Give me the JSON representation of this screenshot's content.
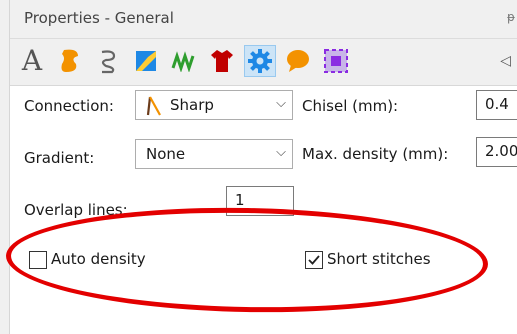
{
  "panel": {
    "title": "Properties - General",
    "pin_glyph": "ᵽ"
  },
  "toolbar": {
    "icons": [
      {
        "name": "text-A-icon",
        "glyph": "A",
        "color": "#555555"
      },
      {
        "name": "fill-shape-icon",
        "color": "#f39200"
      },
      {
        "name": "outline-path-icon",
        "color": "#666666"
      },
      {
        "name": "applique-icon",
        "color": "#1e88e5"
      },
      {
        "name": "stitch-wave-icon",
        "color": "#2e9e2e"
      },
      {
        "name": "shirt-icon",
        "color": "#c00000"
      },
      {
        "name": "settings-gear-icon",
        "color": "#1e88e5",
        "selected": true
      },
      {
        "name": "speech-bubble-icon",
        "color": "#f39200"
      },
      {
        "name": "crop-frame-icon",
        "color": "#8a2be2"
      }
    ],
    "scroll_left_glyph": "◁"
  },
  "form": {
    "connection_label": "Connection:",
    "connection_value": "Sharp",
    "gradient_label": "Gradient:",
    "gradient_value": "None",
    "chisel_label": "Chisel (mm):",
    "chisel_value": "0.4",
    "maxdensity_label": "Max. density (mm):",
    "maxdensity_value": "2.00",
    "overlap_label": "Overlap lines:",
    "overlap_value": "1",
    "auto_density_label": "Auto density",
    "auto_density_checked": false,
    "short_stitches_label": "Short stitches",
    "short_stitches_checked": true,
    "chevron_glyph": "⌵"
  },
  "colors": {
    "highlight_ellipse": "#e30000",
    "selected_tab_bg": "#cce4f7"
  }
}
